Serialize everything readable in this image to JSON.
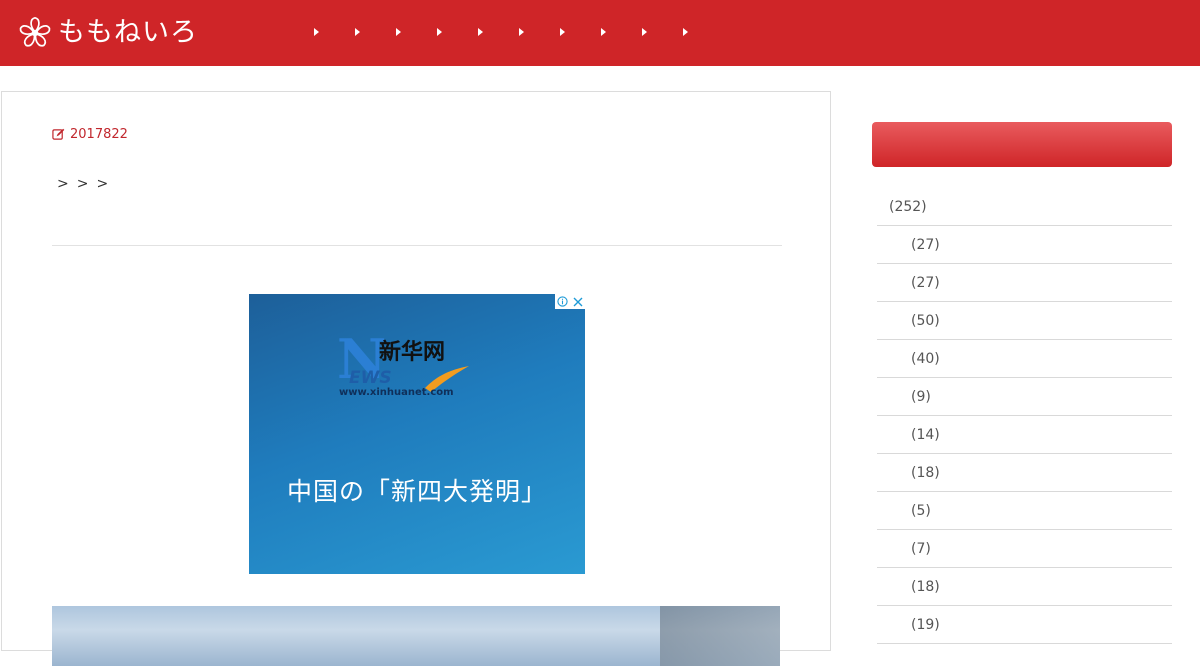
{
  "header": {
    "site_title": "ももねいろ",
    "bg_color": "#cf2528",
    "nav_item_count_note": "",
    "nav": [
      {
        "label": ""
      },
      {
        "label": ""
      },
      {
        "label": ""
      },
      {
        "label": ""
      },
      {
        "label": ""
      },
      {
        "label": ""
      },
      {
        "label": ""
      },
      {
        "label": ""
      },
      {
        "label": ""
      },
      {
        "label": ""
      }
    ]
  },
  "post": {
    "date": "2017822",
    "breadcrumb": [
      ">",
      ">",
      ">"
    ]
  },
  "ad": {
    "brand": "新华网",
    "news": "EWS",
    "n_letter": "N",
    "url": "www.xinhuanet.com",
    "headline": "中国の「新四大発明」"
  },
  "sidebar": {
    "widget_title": "",
    "categories": [
      {
        "label": "(252)",
        "level": "top"
      },
      {
        "label": "(27)",
        "level": "child"
      },
      {
        "label": "(27)",
        "level": "child"
      },
      {
        "label": "(50)",
        "level": "child"
      },
      {
        "label": "(40)",
        "level": "child"
      },
      {
        "label": "(9)",
        "level": "child"
      },
      {
        "label": "(14)",
        "level": "child"
      },
      {
        "label": "(18)",
        "level": "child"
      },
      {
        "label": "(5)",
        "level": "child"
      },
      {
        "label": "(7)",
        "level": "child"
      },
      {
        "label": "(18)",
        "level": "child"
      },
      {
        "label": "(19)",
        "level": "child"
      }
    ]
  },
  "colors": {
    "accent": "#cf2528",
    "date_text": "#c1272d"
  },
  "icons": {
    "logo": "flower-icon",
    "date": "edit-icon",
    "nav": "caret-right-icon",
    "ad_info": "info-icon",
    "ad_close": "close-icon"
  }
}
